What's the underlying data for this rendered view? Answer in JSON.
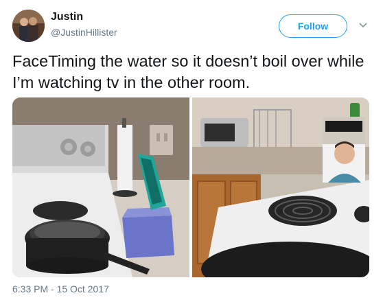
{
  "author": {
    "name": "Justin",
    "handle": "@JustinHillister",
    "avatar_icon": "user-avatar-photo"
  },
  "actions": {
    "follow_label": "Follow",
    "menu_icon": "chevron-down-icon"
  },
  "tweet": {
    "text": "FaceTiming the water so it doesn’t boil over while I’m watching tv in the other room.",
    "timestamp": "6:33 PM - 15 Oct 2017"
  },
  "media": {
    "photos": [
      {
        "icon": "photo-stove-with-phone"
      },
      {
        "icon": "photo-facetime-call-stove"
      }
    ]
  },
  "colors": {
    "accent": "#1da1f2",
    "secondary_text": "#657786",
    "primary_text": "#14171a"
  }
}
